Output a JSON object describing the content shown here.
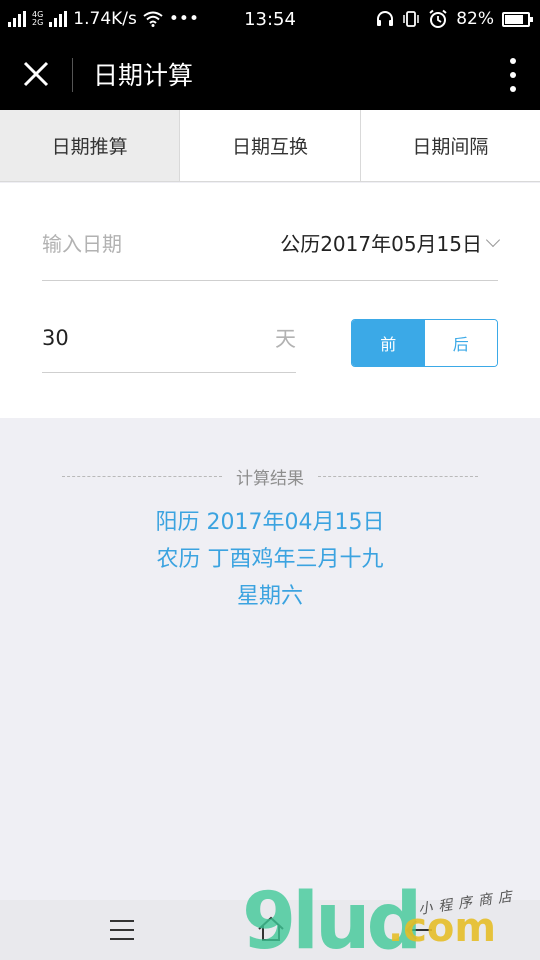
{
  "status_bar": {
    "net_tag_top": "2G",
    "net_tag_4g": "4G",
    "net_tag_2g": "2G",
    "speed": "1.74K/s",
    "dots": "•••",
    "time": "13:54",
    "battery_text": "82%",
    "battery_level": 0.82
  },
  "nav": {
    "title": "日期计算"
  },
  "tabs": [
    {
      "label": "日期推算",
      "active": true
    },
    {
      "label": "日期互换",
      "active": false
    },
    {
      "label": "日期间隔",
      "active": false
    }
  ],
  "form": {
    "date_label": "输入日期",
    "date_value": "公历2017年05月15日",
    "days_value": "30",
    "unit": "天",
    "before_label": "前",
    "after_label": "后",
    "selected": "before"
  },
  "result": {
    "title": "计算结果",
    "solar": "阳历 2017年04月15日",
    "lunar": "农历 丁酉鸡年三月十九",
    "weekday": "星期六"
  },
  "watermark": {
    "main": "9lud",
    "dot": ".com",
    "slogan": "小程序商店"
  },
  "colors": {
    "accent": "#3ba9e7",
    "result_text": "#3ba3e0",
    "background": "#efeff4"
  }
}
